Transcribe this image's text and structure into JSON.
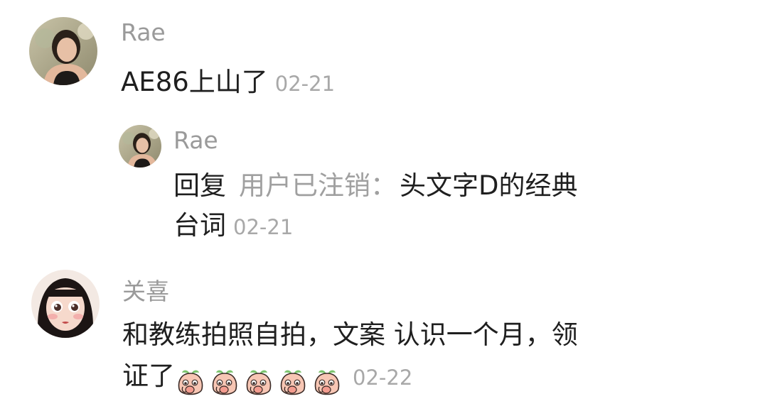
{
  "comments": [
    {
      "username": "Rae",
      "text": "AE86上山了",
      "time": "02-21"
    },
    {
      "username": "Rae",
      "reply_prefix": "回复",
      "reply_target": "用户已注销",
      "reply_separator": "：",
      "text_line1": "头文字D的经典",
      "text_line2": "台词",
      "time": "02-21"
    },
    {
      "username": "关喜",
      "text_line1": "和教练拍照自拍，文案 认识一个月，领",
      "text_line2": "证了",
      "emoji_icons": [
        "peach-emoji-icon",
        "peach-emoji-icon",
        "peach-emoji-icon",
        "peach-emoji-icon",
        "peach-emoji-icon"
      ],
      "time": "02-22"
    }
  ],
  "colors": {
    "username": "#9a9a9a",
    "text": "#1f1f1f",
    "timestamp": "#a8a8a8",
    "reply_target": "#a0a0a0"
  }
}
